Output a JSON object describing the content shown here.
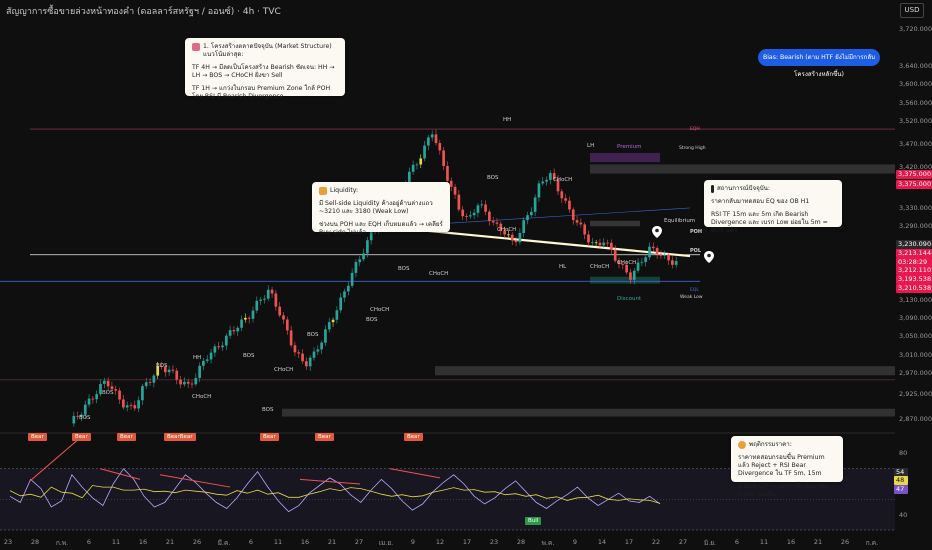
{
  "header": {
    "title": "สัญญาการซื้อขายล่วงหน้าทองคำ (ดอลลาร์สหรัฐฯ / ออนซ์) · 4h · TVC",
    "currency_button": "USD"
  },
  "price_axis": {
    "ticks": [
      "3,720.000",
      "3,640.000",
      "3,600.000",
      "3,560.000",
      "3,520.000",
      "3,470.000",
      "3,420.000",
      "3,330.000",
      "3,290.000",
      "3,250.000",
      "3,170.000",
      "3,130.000",
      "3,090.000",
      "3,050.000",
      "3,010.000",
      "2,970.000",
      "2,925.000",
      "2,870.000"
    ],
    "badges": [
      {
        "text": "3,375.000",
        "color": "#e8174e"
      },
      {
        "text": "3,375.000",
        "color": "#e8174e"
      },
      {
        "text": "3,230.090",
        "color": "#2a2a2a"
      },
      {
        "text": "3,213.144",
        "color": "#e8174e"
      },
      {
        "text": "03:28:29",
        "color": "#e8174e"
      },
      {
        "text": "3,212.110",
        "color": "#e8174e"
      },
      {
        "text": "3,193.538",
        "color": "#e8174e"
      },
      {
        "text": "3,210.538",
        "color": "#e8174e"
      }
    ]
  },
  "rsi_axis": {
    "ticks": [
      "80",
      "60",
      "40"
    ],
    "badges": [
      {
        "text": "54",
        "color": "#2b2b2b"
      },
      {
        "text": "48",
        "color": "#e6d84a"
      },
      {
        "text": "47",
        "color": "#7a52c9"
      }
    ]
  },
  "time_axis": [
    "23",
    "28",
    "ก.พ.",
    "6",
    "11",
    "16",
    "21",
    "26",
    "มี.ค.",
    "6",
    "11",
    "16",
    "21",
    "27",
    "เม.ย.",
    "9",
    "12",
    "17",
    "23",
    "28",
    "พ.ค.",
    "9",
    "14",
    "17",
    "22",
    "27",
    "มิ.ย.",
    "6",
    "11",
    "16",
    "21",
    "26",
    "ก.ค."
  ],
  "notes": {
    "market_structure": {
      "title": "1. โครงสร้างตลาดปัจจุบัน (Market Structure)",
      "subtitle": "แนวโน้มล่าสุด:",
      "line1": "TF 4H → มีลดเป็นโครงสร้าง Bearish ชัดเจน: HH → LH → BOS → CHoCH ฝั่งขา Sell",
      "line2": "TF 1H → แกว่งในกรอบ Premium Zone ใกล้ POH โดย RSI มี Bearish Divergence"
    },
    "bias": "Bias: Bearish (ตาม HTF ยังไม่มีการกลับโครงสร้างหลักขึ้น)",
    "liquidity": {
      "title": "Liquidity:",
      "line1": "มี Sell-side Liquidity ค้างอยู่ด้านล่างแถว ~3210 และ 3180 (Weak Low)",
      "line2": "ช่วงบน POH และ EQH เก็บหมดแล้ว → เคลียร์ Buy-side ไปแล้ว"
    },
    "current_state": {
      "title": "สถานการณ์ปัจจุบัน:",
      "line1": "ราคากลับมาทดสอบ EQ ของ OB H1",
      "line2": "RSI TF 15m และ 5m เกิด Bearish Divergence และ เบรก Low ย่อยใน 5m = BOS แล้ว"
    },
    "forecast": {
      "title": "พฤติกรรมราคา:",
      "line1": "ราคาทดสอบกรอบขึ้น Premium แล้ว Reject + RSI Bear Divergence ใน TF 5m, 15m",
      "line2": "มี BOS LTF = บอกว่าฝั่ง Buy จบ Cycle รอบสั้น"
    }
  },
  "chart_labels": {
    "hh": "HH",
    "lh": "LH",
    "hl": "HL",
    "bos": "BOS",
    "choch": "CHoCH",
    "premium": "Premium",
    "discount": "Discount",
    "equilibrium": "Equilibrium",
    "strong_high": "Strong High",
    "weak_low": "Weak Low",
    "poh": "POH",
    "pol": "POL",
    "eqh": "EQH",
    "eql": "EQL"
  },
  "rsi_tags": {
    "bear": "Bear",
    "bull": "Bull",
    "bearbear": "BearBear"
  },
  "colors": {
    "up": "#26a69a",
    "down": "#ef5350",
    "bias": "#1e5ee6",
    "accent": "#e8174e",
    "rsi": "#b5a8ff",
    "rsi_ma": "#e6d84a"
  },
  "chart_data": {
    "type": "candlestick",
    "symbol": "XAU/USD futures",
    "timeframe": "4h",
    "price_range": [
      2850,
      3740
    ],
    "close_path": [
      2860,
      2880,
      2905,
      2930,
      2955,
      2925,
      2900,
      2890,
      2935,
      2960,
      2985,
      2975,
      2955,
      2940,
      2965,
      3005,
      3020,
      3040,
      3065,
      3080,
      3100,
      3130,
      3150,
      3110,
      3060,
      3010,
      2990,
      3010,
      3050,
      3090,
      3130,
      3180,
      3220,
      3260,
      3300,
      3330,
      3360,
      3390,
      3420,
      3450,
      3500,
      3440,
      3380,
      3330,
      3300,
      3340,
      3320,
      3290,
      3280,
      3250,
      3290,
      3330,
      3385,
      3405,
      3370,
      3330,
      3300,
      3270,
      3245,
      3260,
      3230,
      3200,
      3180,
      3210,
      3240,
      3235,
      3215,
      3213
    ],
    "rsi_range": [
      30,
      90
    ],
    "rsi_values": [
      52,
      48,
      63,
      57,
      45,
      49,
      66,
      58,
      51,
      46,
      60,
      70,
      63,
      52,
      45,
      48,
      57,
      66,
      61,
      54,
      48,
      44,
      51,
      60,
      68,
      58,
      49,
      42,
      46,
      54,
      59,
      64,
      60,
      53,
      48,
      56,
      63,
      57,
      49,
      43,
      47,
      55,
      61,
      66,
      60,
      52,
      47,
      51,
      57,
      62,
      55,
      48,
      44,
      49,
      53,
      58,
      51,
      46,
      50,
      54,
      49,
      48,
      52,
      47
    ]
  }
}
